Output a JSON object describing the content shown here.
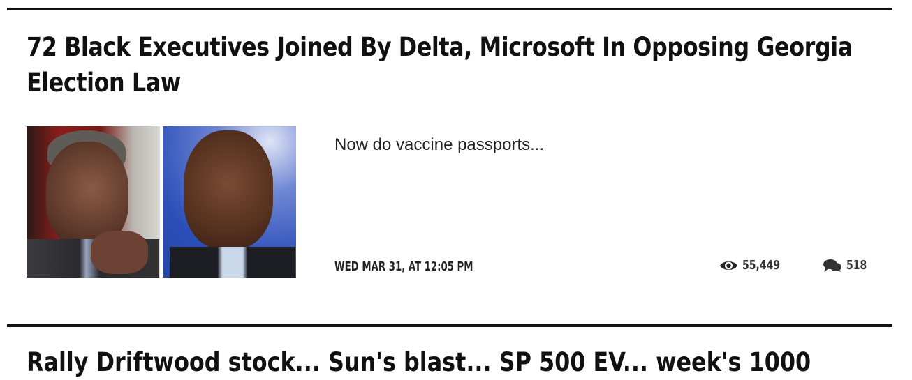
{
  "article": {
    "headline": "72 Black Executives Joined By Delta, Microsoft In Opposing Georgia Election Law",
    "summary": "Now do vaccine passports...",
    "date": "WED MAR 31, AT 12:05 PM",
    "views": "55,449",
    "comments": "518",
    "icons": {
      "views": "eye-icon",
      "comments": "comments-icon"
    }
  },
  "next_article": {
    "headline_partial": "Rally Driftwood stock... Sun's blast... SP 500 EV... week's 1000"
  },
  "colors": {
    "rule": "#111111",
    "text": "#111111",
    "meta": "#222222"
  }
}
